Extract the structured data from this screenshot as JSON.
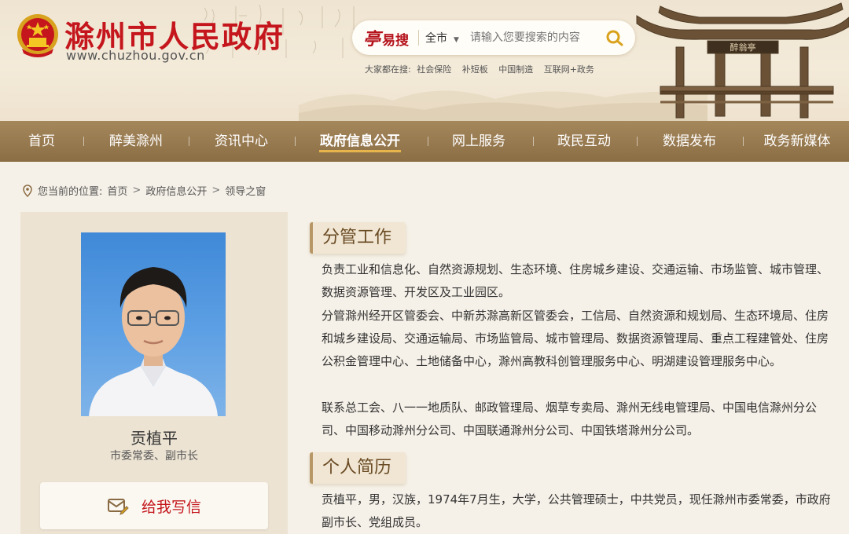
{
  "header": {
    "site_title": "滁州市人民政府",
    "site_url": "www.chuzhou.gov.cn",
    "search": {
      "logo_mark": "亭",
      "logo_text": "易搜",
      "scope": "全市",
      "placeholder": "请输入您要搜索的内容"
    },
    "hot_label": "大家都在搜:",
    "hot_terms": [
      "社会保险",
      "补短板",
      "中国制造",
      "互联网+政务"
    ],
    "pavilion_plaque": "醉翁亭"
  },
  "nav": {
    "items": [
      {
        "label": "首页"
      },
      {
        "label": "醉美滁州"
      },
      {
        "label": "资讯中心"
      },
      {
        "label": "政府信息公开"
      },
      {
        "label": "网上服务"
      },
      {
        "label": "政民互动"
      },
      {
        "label": "数据发布"
      },
      {
        "label": "政务新媒体"
      }
    ],
    "active_index": 3
  },
  "breadcrumb": {
    "prefix": "您当前的位置:",
    "items": [
      "首页",
      "政府信息公开",
      "领导之窗"
    ],
    "separator": ">"
  },
  "profile": {
    "name": "贡植平",
    "title": "市委常委、副市长",
    "mail_button": "给我写信"
  },
  "sections": {
    "duty_heading": "分管工作",
    "duty_paragraphs": [
      "负责工业和信息化、自然资源规划、生态环境、住房城乡建设、交通运输、市场监管、城市管理、数据资源管理、开发区及工业园区。",
      "分管滁州经开区管委会、中新苏滁高新区管委会，工信局、自然资源和规划局、生态环境局、住房和城乡建设局、交通运输局、市场监管局、城市管理局、数据资源管理局、重点工程建管处、住房公积金管理中心、土地储备中心，滁州高教科创管理服务中心、明湖建设管理服务中心。",
      "联系总工会、八一一地质队、邮政管理局、烟草专卖局、滁州无线电管理局、中国电信滁州分公司、中国移动滁州分公司、中国联通滁州分公司、中国铁塔滁州分公司。"
    ],
    "bio_heading": "个人简历",
    "bio_paragraphs": [
      "贡植平，男，汉族，1974年7月生，大学，公共管理硕士，中共党员，现任滁州市委常委，市政府副市长、党组成员。"
    ]
  },
  "colors": {
    "brand_red": "#c4161c",
    "nav_brown": "#9a7c52",
    "nav_active_underline": "#e8b44c",
    "page_bg": "#f6f1e8",
    "card_bg": "#ece3d3"
  },
  "icons": {
    "emblem": "national-emblem",
    "search": "search-icon",
    "location": "location-pin-icon",
    "mail": "mail-edit-icon"
  }
}
